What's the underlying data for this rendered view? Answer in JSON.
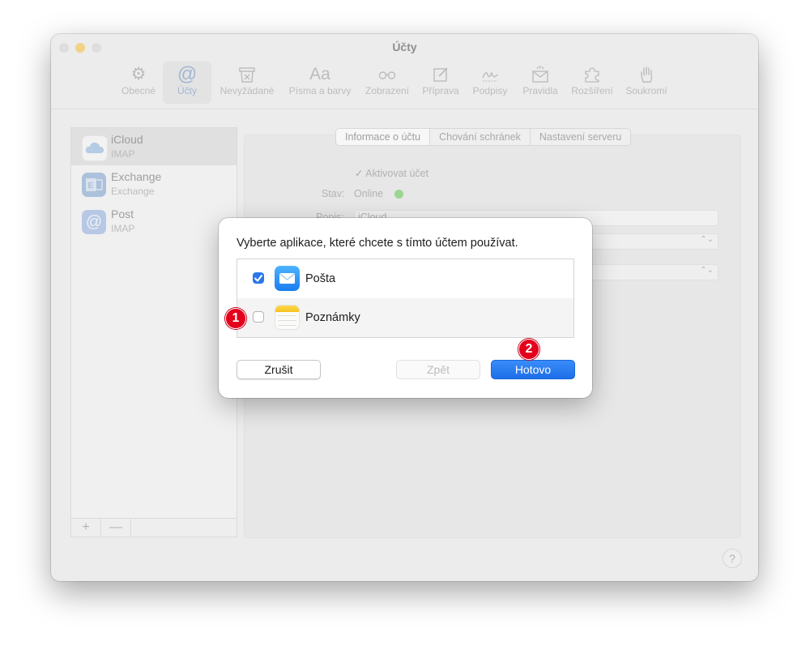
{
  "window": {
    "title": "Účty",
    "traffic_colors": [
      "#d4d4d4",
      "#f5bf3d",
      "#d4d4d4"
    ]
  },
  "toolbar": {
    "items": [
      {
        "label": "Obecné",
        "icon": "gear-icon"
      },
      {
        "label": "Účty",
        "icon": "at-icon",
        "active": true
      },
      {
        "label": "Nevyžádané",
        "icon": "junk-bin-icon"
      },
      {
        "label": "Písma a barvy",
        "icon": "fonts-icon"
      },
      {
        "label": "Zobrazení",
        "icon": "glasses-icon"
      },
      {
        "label": "Příprava",
        "icon": "compose-icon"
      },
      {
        "label": "Podpisy",
        "icon": "signature-icon"
      },
      {
        "label": "Pravidla",
        "icon": "rules-envelope-icon"
      },
      {
        "label": "Rozšíření",
        "icon": "puzzle-icon"
      },
      {
        "label": "Soukromí",
        "icon": "hand-icon"
      }
    ]
  },
  "sidebar": {
    "accounts": [
      {
        "name": "iCloud",
        "type": "IMAP",
        "icon": "icloud-icon",
        "selected": true
      },
      {
        "name": "Exchange",
        "type": "Exchange",
        "icon": "exchange-icon"
      },
      {
        "name": "Post",
        "type": "IMAP",
        "icon": "at-mail-icon"
      }
    ],
    "add_label": "+",
    "remove_label": "—"
  },
  "account_panel": {
    "tabs": [
      "Informace o účtu",
      "Chování schránek",
      "Nastavení serveru"
    ],
    "enable_label": "Aktivovat účet",
    "status_label": "Stav:",
    "status_value": "Online",
    "status_color": "#62c554",
    "description_label": "Popis:",
    "description_value": "iCloud"
  },
  "help_label": "?",
  "dialog": {
    "message": "Vyberte aplikace, které chcete s tímto účtem používat.",
    "apps": [
      {
        "label": "Pošta",
        "checked": true,
        "icon": "mail-app-icon"
      },
      {
        "label": "Poznámky",
        "checked": false,
        "icon": "notes-app-icon"
      }
    ],
    "cancel_label": "Zrušit",
    "back_label": "Zpět",
    "done_label": "Hotovo",
    "accent_color": "#1d6fe8"
  },
  "callouts": [
    "1",
    "2"
  ]
}
